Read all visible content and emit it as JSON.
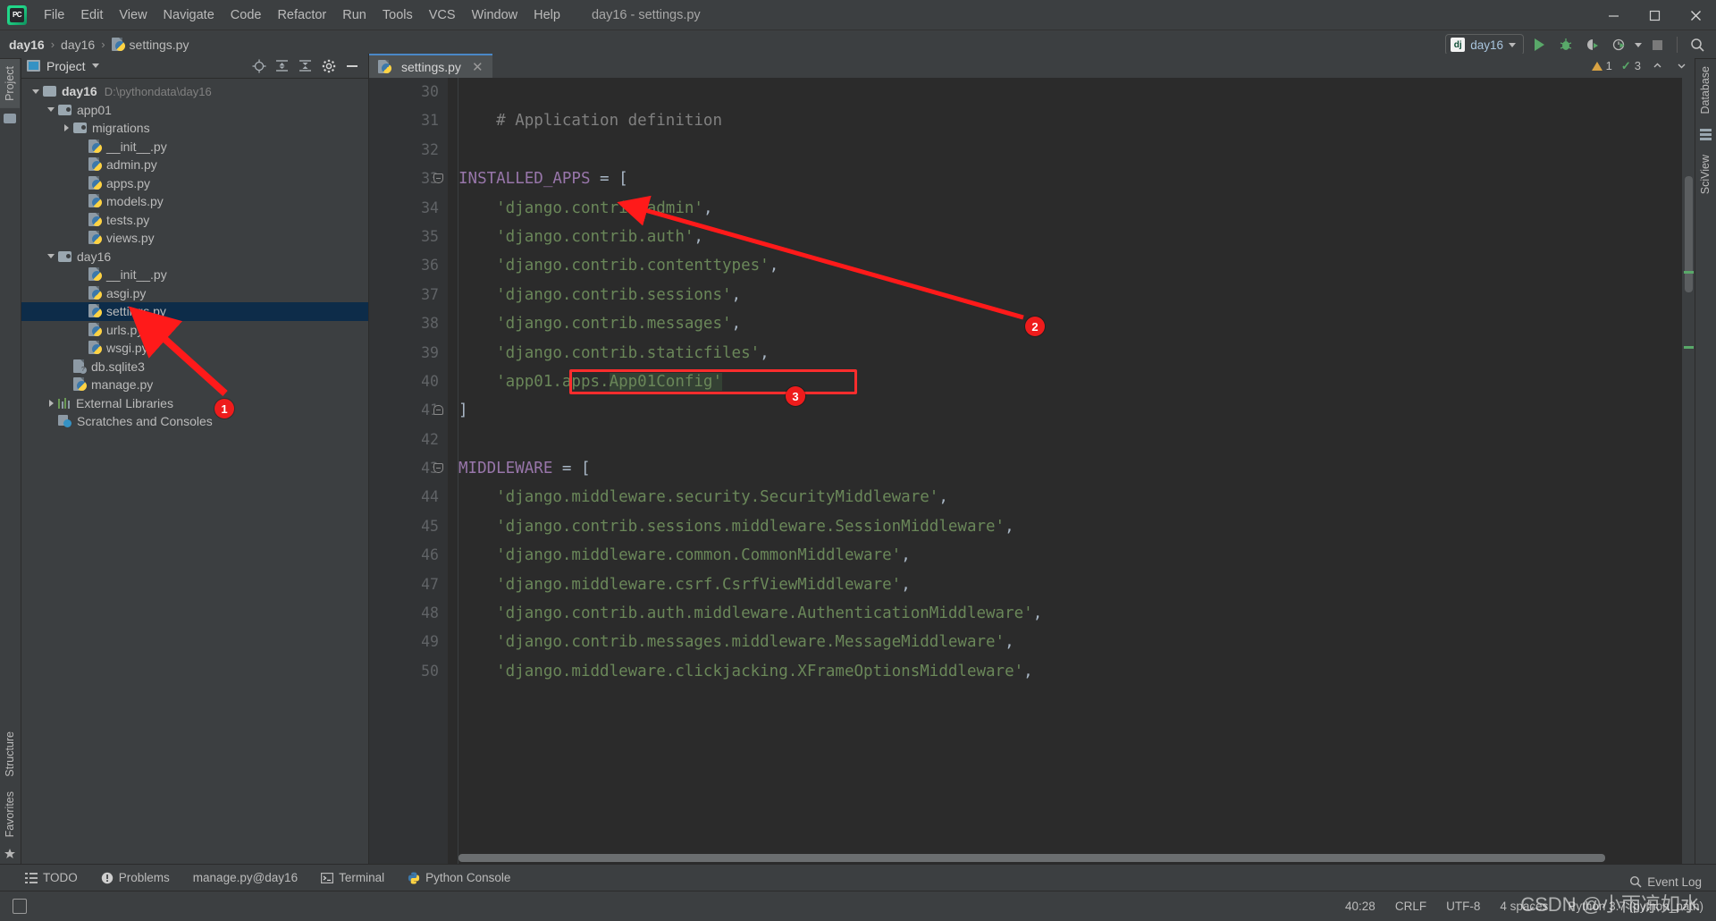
{
  "window": {
    "title": "day16 - settings.py",
    "minimize_label": "–",
    "maximize_label": "❐",
    "close_label": "✕"
  },
  "menubar": {
    "items": [
      {
        "label": "File",
        "name": "menu-file"
      },
      {
        "label": "Edit",
        "name": "menu-edit"
      },
      {
        "label": "View",
        "name": "menu-view"
      },
      {
        "label": "Navigate",
        "name": "menu-navigate"
      },
      {
        "label": "Code",
        "name": "menu-code"
      },
      {
        "label": "Refactor",
        "name": "menu-refactor"
      },
      {
        "label": "Run",
        "name": "menu-run"
      },
      {
        "label": "Tools",
        "name": "menu-tools"
      },
      {
        "label": "VCS",
        "name": "menu-vcs"
      },
      {
        "label": "Window",
        "name": "menu-window"
      },
      {
        "label": "Help",
        "name": "menu-help"
      }
    ]
  },
  "breadcrumb": {
    "items": [
      "day16",
      "day16",
      "settings.py"
    ],
    "separator": "›"
  },
  "toolbar": {
    "run_config": "day16",
    "run_config_icon": "django-icon",
    "buttons": [
      "run-button",
      "debug-button",
      "coverage-button",
      "profile-button",
      "stop-button",
      "search-everywhere-button"
    ]
  },
  "left_strip": {
    "top_tabs": [
      "Project"
    ],
    "bottom_tabs": [
      "Structure",
      "Favorites"
    ]
  },
  "right_strip": {
    "tabs": [
      "Database",
      "SciView"
    ]
  },
  "project_panel": {
    "title": "Project",
    "header_icons": [
      "locate-icon",
      "expand-all-icon",
      "collapse-all-icon",
      "settings-gear-icon",
      "hide-icon"
    ],
    "tree": [
      {
        "label": "day16",
        "path": "D:\\pythondata\\day16",
        "indent": 0,
        "twist": "down",
        "icon": "folder",
        "bold": true,
        "selected": false
      },
      {
        "label": "app01",
        "path": "",
        "indent": 1,
        "twist": "down",
        "icon": "module-folder",
        "bold": false,
        "selected": false
      },
      {
        "label": "migrations",
        "path": "",
        "indent": 2,
        "twist": "right",
        "icon": "module-folder",
        "bold": false,
        "selected": false
      },
      {
        "label": "__init__.py",
        "path": "",
        "indent": 3,
        "twist": "none",
        "icon": "python-file",
        "bold": false,
        "selected": false
      },
      {
        "label": "admin.py",
        "path": "",
        "indent": 3,
        "twist": "none",
        "icon": "python-file",
        "bold": false,
        "selected": false
      },
      {
        "label": "apps.py",
        "path": "",
        "indent": 3,
        "twist": "none",
        "icon": "python-file",
        "bold": false,
        "selected": false
      },
      {
        "label": "models.py",
        "path": "",
        "indent": 3,
        "twist": "none",
        "icon": "python-file",
        "bold": false,
        "selected": false
      },
      {
        "label": "tests.py",
        "path": "",
        "indent": 3,
        "twist": "none",
        "icon": "python-file",
        "bold": false,
        "selected": false
      },
      {
        "label": "views.py",
        "path": "",
        "indent": 3,
        "twist": "none",
        "icon": "python-file",
        "bold": false,
        "selected": false
      },
      {
        "label": "day16",
        "path": "",
        "indent": 1,
        "twist": "down",
        "icon": "module-folder",
        "bold": false,
        "selected": false
      },
      {
        "label": "__init__.py",
        "path": "",
        "indent": 3,
        "twist": "none",
        "icon": "python-file",
        "bold": false,
        "selected": false
      },
      {
        "label": "asgi.py",
        "path": "",
        "indent": 3,
        "twist": "none",
        "icon": "python-file",
        "bold": false,
        "selected": false
      },
      {
        "label": "settings.py",
        "path": "",
        "indent": 3,
        "twist": "none",
        "icon": "python-file",
        "bold": false,
        "selected": true
      },
      {
        "label": "urls.py",
        "path": "",
        "indent": 3,
        "twist": "none",
        "icon": "python-file",
        "bold": false,
        "selected": false
      },
      {
        "label": "wsgi.py",
        "path": "",
        "indent": 3,
        "twist": "none",
        "icon": "python-file",
        "bold": false,
        "selected": false
      },
      {
        "label": "db.sqlite3",
        "path": "",
        "indent": 2,
        "twist": "none",
        "icon": "unknown-file",
        "bold": false,
        "selected": false
      },
      {
        "label": "manage.py",
        "path": "",
        "indent": 2,
        "twist": "none",
        "icon": "python-file",
        "bold": false,
        "selected": false
      },
      {
        "label": "External Libraries",
        "path": "",
        "indent": 1,
        "twist": "right",
        "icon": "library",
        "bold": false,
        "selected": false
      },
      {
        "label": "Scratches and Consoles",
        "path": "",
        "indent": 1,
        "twist": "none",
        "icon": "scratch",
        "bold": false,
        "selected": false
      }
    ]
  },
  "editor": {
    "tab": {
      "label": "settings.py",
      "close": "✕",
      "icon": "python-file"
    },
    "inspections": {
      "warning_count": "1",
      "ok_count": "3"
    },
    "first_line": 30,
    "lines": [
      {
        "n": 30,
        "tokens": []
      },
      {
        "n": 31,
        "tokens": [
          {
            "t": "comment",
            "v": "    # Application definition"
          }
        ]
      },
      {
        "n": 32,
        "tokens": []
      },
      {
        "n": 33,
        "tokens": [
          {
            "t": "const",
            "v": "INSTALLED_APPS"
          },
          {
            "t": "op",
            "v": " = "
          },
          {
            "t": "punct",
            "v": "["
          }
        ],
        "fold": "start"
      },
      {
        "n": 34,
        "tokens": [
          {
            "t": "str",
            "v": "    'django.contrib.admin'"
          },
          {
            "t": "punct",
            "v": ","
          }
        ]
      },
      {
        "n": 35,
        "tokens": [
          {
            "t": "str",
            "v": "    'django.contrib.auth'"
          },
          {
            "t": "punct",
            "v": ","
          }
        ]
      },
      {
        "n": 36,
        "tokens": [
          {
            "t": "str",
            "v": "    'django.contrib.contenttypes'"
          },
          {
            "t": "punct",
            "v": ","
          }
        ]
      },
      {
        "n": 37,
        "tokens": [
          {
            "t": "str",
            "v": "    'django.contrib.sessions'"
          },
          {
            "t": "punct",
            "v": ","
          }
        ]
      },
      {
        "n": 38,
        "tokens": [
          {
            "t": "str",
            "v": "    'django.contrib.messages'"
          },
          {
            "t": "punct",
            "v": ","
          }
        ]
      },
      {
        "n": 39,
        "tokens": [
          {
            "t": "str",
            "v": "    'django.contrib.staticfiles'"
          },
          {
            "t": "punct",
            "v": ","
          }
        ]
      },
      {
        "n": 40,
        "tokens": [
          {
            "t": "str",
            "v": "    'app01.apps."
          },
          {
            "t": "str-hl",
            "v": "App01Config'"
          }
        ],
        "boxed": true
      },
      {
        "n": 41,
        "tokens": [
          {
            "t": "punct",
            "v": "]"
          }
        ],
        "fold": "end"
      },
      {
        "n": 42,
        "tokens": []
      },
      {
        "n": 43,
        "tokens": [
          {
            "t": "const",
            "v": "MIDDLEWARE"
          },
          {
            "t": "op",
            "v": " = "
          },
          {
            "t": "punct",
            "v": "["
          }
        ],
        "fold": "start"
      },
      {
        "n": 44,
        "tokens": [
          {
            "t": "str",
            "v": "    'django.middleware.security.SecurityMiddleware'"
          },
          {
            "t": "punct",
            "v": ","
          }
        ]
      },
      {
        "n": 45,
        "tokens": [
          {
            "t": "str",
            "v": "    'django.contrib.sessions.middleware.SessionMiddleware'"
          },
          {
            "t": "punct",
            "v": ","
          }
        ]
      },
      {
        "n": 46,
        "tokens": [
          {
            "t": "str",
            "v": "    'django.middleware.common.CommonMiddleware'"
          },
          {
            "t": "punct",
            "v": ","
          }
        ]
      },
      {
        "n": 47,
        "tokens": [
          {
            "t": "str",
            "v": "    'django.middleware.csrf.CsrfViewMiddleware'"
          },
          {
            "t": "punct",
            "v": ","
          }
        ]
      },
      {
        "n": 48,
        "tokens": [
          {
            "t": "str",
            "v": "    'django.contrib.auth.middleware.AuthenticationMiddleware'"
          },
          {
            "t": "punct",
            "v": ","
          }
        ]
      },
      {
        "n": 49,
        "tokens": [
          {
            "t": "str",
            "v": "    'django.contrib.messages.middleware.MessageMiddleware'"
          },
          {
            "t": "punct",
            "v": ","
          }
        ]
      },
      {
        "n": 50,
        "tokens": [
          {
            "t": "str",
            "v": "    'django.middleware.clickjacking.XFrameOptionsMiddleware'"
          },
          {
            "t": "punct",
            "v": ","
          }
        ]
      }
    ]
  },
  "annotations": [
    {
      "id": "1",
      "label": "1"
    },
    {
      "id": "2",
      "label": "2"
    },
    {
      "id": "3",
      "label": "3"
    }
  ],
  "bottom_bar": {
    "items": [
      {
        "label": "TODO",
        "icon": "todo-icon"
      },
      {
        "label": "Problems",
        "icon": "problems-icon"
      },
      {
        "label": "manage.py@day16",
        "icon": ""
      },
      {
        "label": "Terminal",
        "icon": "terminal-icon"
      },
      {
        "label": "Python Console",
        "icon": "python-icon"
      }
    ]
  },
  "status_bar": {
    "event_log": "Event Log",
    "caret": "40:28",
    "line_sep": "CRLF",
    "encoding": "UTF-8",
    "indent": "4 spaces",
    "interpreter": "Python 3.7 (python_path)"
  },
  "watermark": "CSDN @小雨凉如水",
  "colors": {
    "bg_panel": "#3c3f41",
    "bg_editor": "#2b2b2b",
    "gutter": "#313335",
    "selection": "#0d2c49",
    "string": "#6a8759",
    "constant": "#9876aa",
    "text": "#a9b7c6",
    "comment": "#808080",
    "accent_red": "#ff2d2d",
    "accent_green": "#59a869",
    "tab_active_underline": "#4a88c7"
  }
}
